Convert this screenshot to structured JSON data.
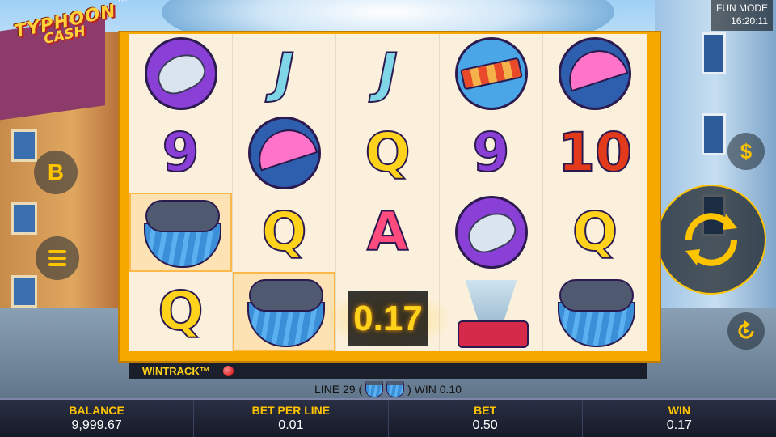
{
  "logo": {
    "line1": "TYPHOON",
    "line2": "CASH",
    "tm": "TM"
  },
  "status": {
    "mode": "FUN MODE",
    "time": "16:20:11"
  },
  "controls": {
    "b_label": "B",
    "dollar_label": "$"
  },
  "reels": [
    [
      "satellite-dish",
      "J",
      "J",
      "windsock",
      "umbrella"
    ],
    [
      "9",
      "umbrella",
      "Q",
      "9",
      "10"
    ],
    [
      "storm-cloud",
      "Q",
      "A",
      "satellite-dish",
      "Q"
    ],
    [
      "Q",
      "storm-cloud",
      "mystery",
      "tornado-cash",
      "storm-cloud"
    ]
  ],
  "win_amount": "0.17",
  "wintrack_label": "WINTRACK™",
  "line_win": {
    "prefix": "LINE 29 (",
    "suffix": ") WIN 0.10"
  },
  "stats": [
    {
      "label": "BALANCE",
      "value": "9,999.67"
    },
    {
      "label": "BET PER LINE",
      "value": "0.01"
    },
    {
      "label": "BET",
      "value": "0.50"
    },
    {
      "label": "WIN",
      "value": "0.17"
    }
  ],
  "colors": {
    "accent": "#ffc400",
    "frame": "#f6a800",
    "bar": "#161a28"
  }
}
